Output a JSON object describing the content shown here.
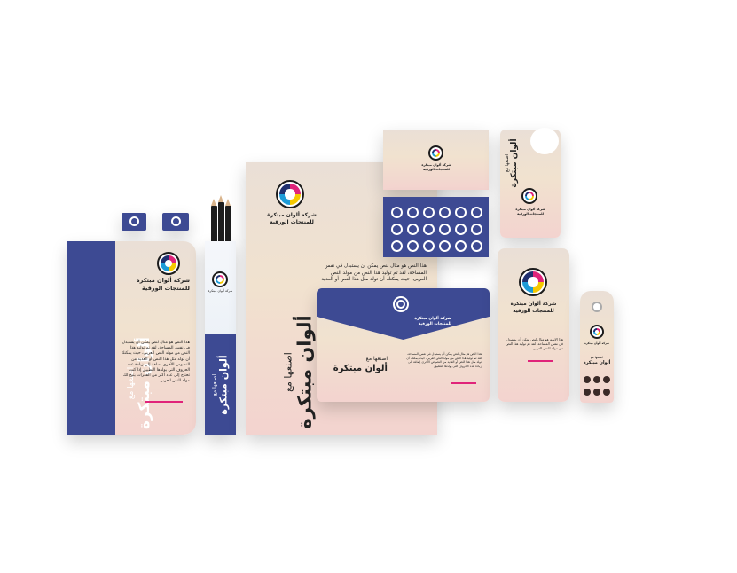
{
  "brand": {
    "company_line1": "شركة ألوان مبتكرة",
    "company_line2": "للمنتجات الورقية",
    "slogan_vertical": "ألوان مبتكرة",
    "slogan_pre": "اصنعها مع"
  },
  "notebook": {
    "body": "هذا النص هو مثال لنص يمكن أن يستبدل في نفس المساحة، لقد تم توليد هذا النص من مولد النص العربى، حيث يمكنك أن تولد مثل هذا النص أو العديد من النصوص الأخرى إضافة إلى زيادة عدد الحروف التى يولدها التطبيق إذا كنت تحتاج إلى عدد أكبر من الفقرات يتيح لك مولد النص العربى"
  },
  "letterhead": {
    "body": "هذا النص هو مثال لنص يمكن أن يستبدل في نفس المساحة، لقد تم توليد هذا النص من مولد النص العربى، حيث يمكنك أن تولد مثل هذا النص أو العديد"
  },
  "envelope": {
    "title_pre": "اصنعها مع",
    "title": "ألوان مبتكرة",
    "body": "هذا النص هو مثال لنص يمكن أن يستبدل في نفس المساحة، لقد تم توليد هذا النص من مولد النص العربى، حيث يمكنك أن تولد مثل هذا النص أو العديد من النصوص الأخرى إضافة إلى زيادة عدد الحروف التى يولدها التطبيق"
  },
  "phone_card": {
    "body": "هذا الاسم هو مثال لنص يمكن أن يستبدل في نفس المساحة، لقد تم توليد هذا النص من مولد النص العربى"
  },
  "hang_tag": {
    "pre": "اصنعها مع",
    "title": "ألوان مبتكرة"
  },
  "colors": {
    "navy": "#3d4a93",
    "pink": "#e0247a",
    "cream": "#f1e2cf"
  }
}
